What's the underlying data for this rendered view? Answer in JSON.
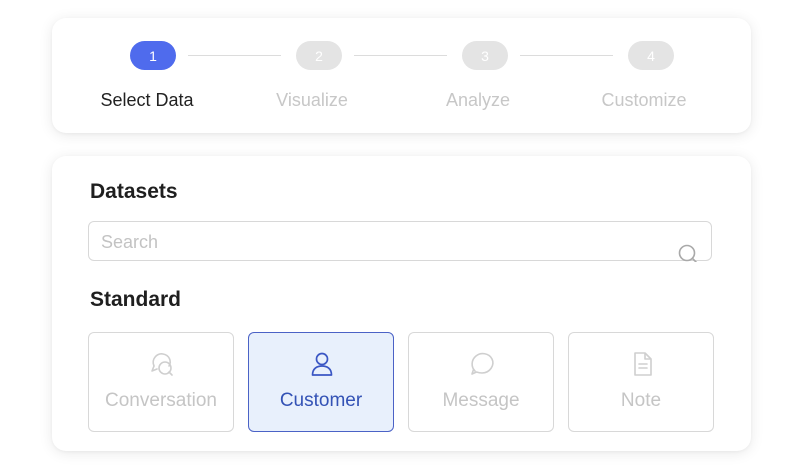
{
  "stepper": {
    "steps": [
      {
        "number": "1",
        "label": "Select Data",
        "state": "active"
      },
      {
        "number": "2",
        "label": "Visualize",
        "state": "inactive"
      },
      {
        "number": "3",
        "label": "Analyze",
        "state": "inactive"
      },
      {
        "number": "4",
        "label": "Customize",
        "state": "inactive"
      }
    ]
  },
  "datasets": {
    "title": "Datasets",
    "search": {
      "placeholder": "Search",
      "value": "",
      "icon": "search-icon"
    },
    "standard_title": "Standard",
    "tiles": [
      {
        "label": "Conversation",
        "icon": "conversation-icon",
        "selected": false
      },
      {
        "label": "Customer",
        "icon": "user-icon",
        "selected": true
      },
      {
        "label": "Message",
        "icon": "message-bubble-icon",
        "selected": false
      },
      {
        "label": "Note",
        "icon": "document-icon",
        "selected": false
      }
    ]
  },
  "colors": {
    "accent": "#4f6bed",
    "selected_tile_bg": "#e8f0fc",
    "selected_tile_border": "#4b62c6",
    "selected_tile_text": "#3352b5",
    "inactive": "#c5c5c5"
  }
}
